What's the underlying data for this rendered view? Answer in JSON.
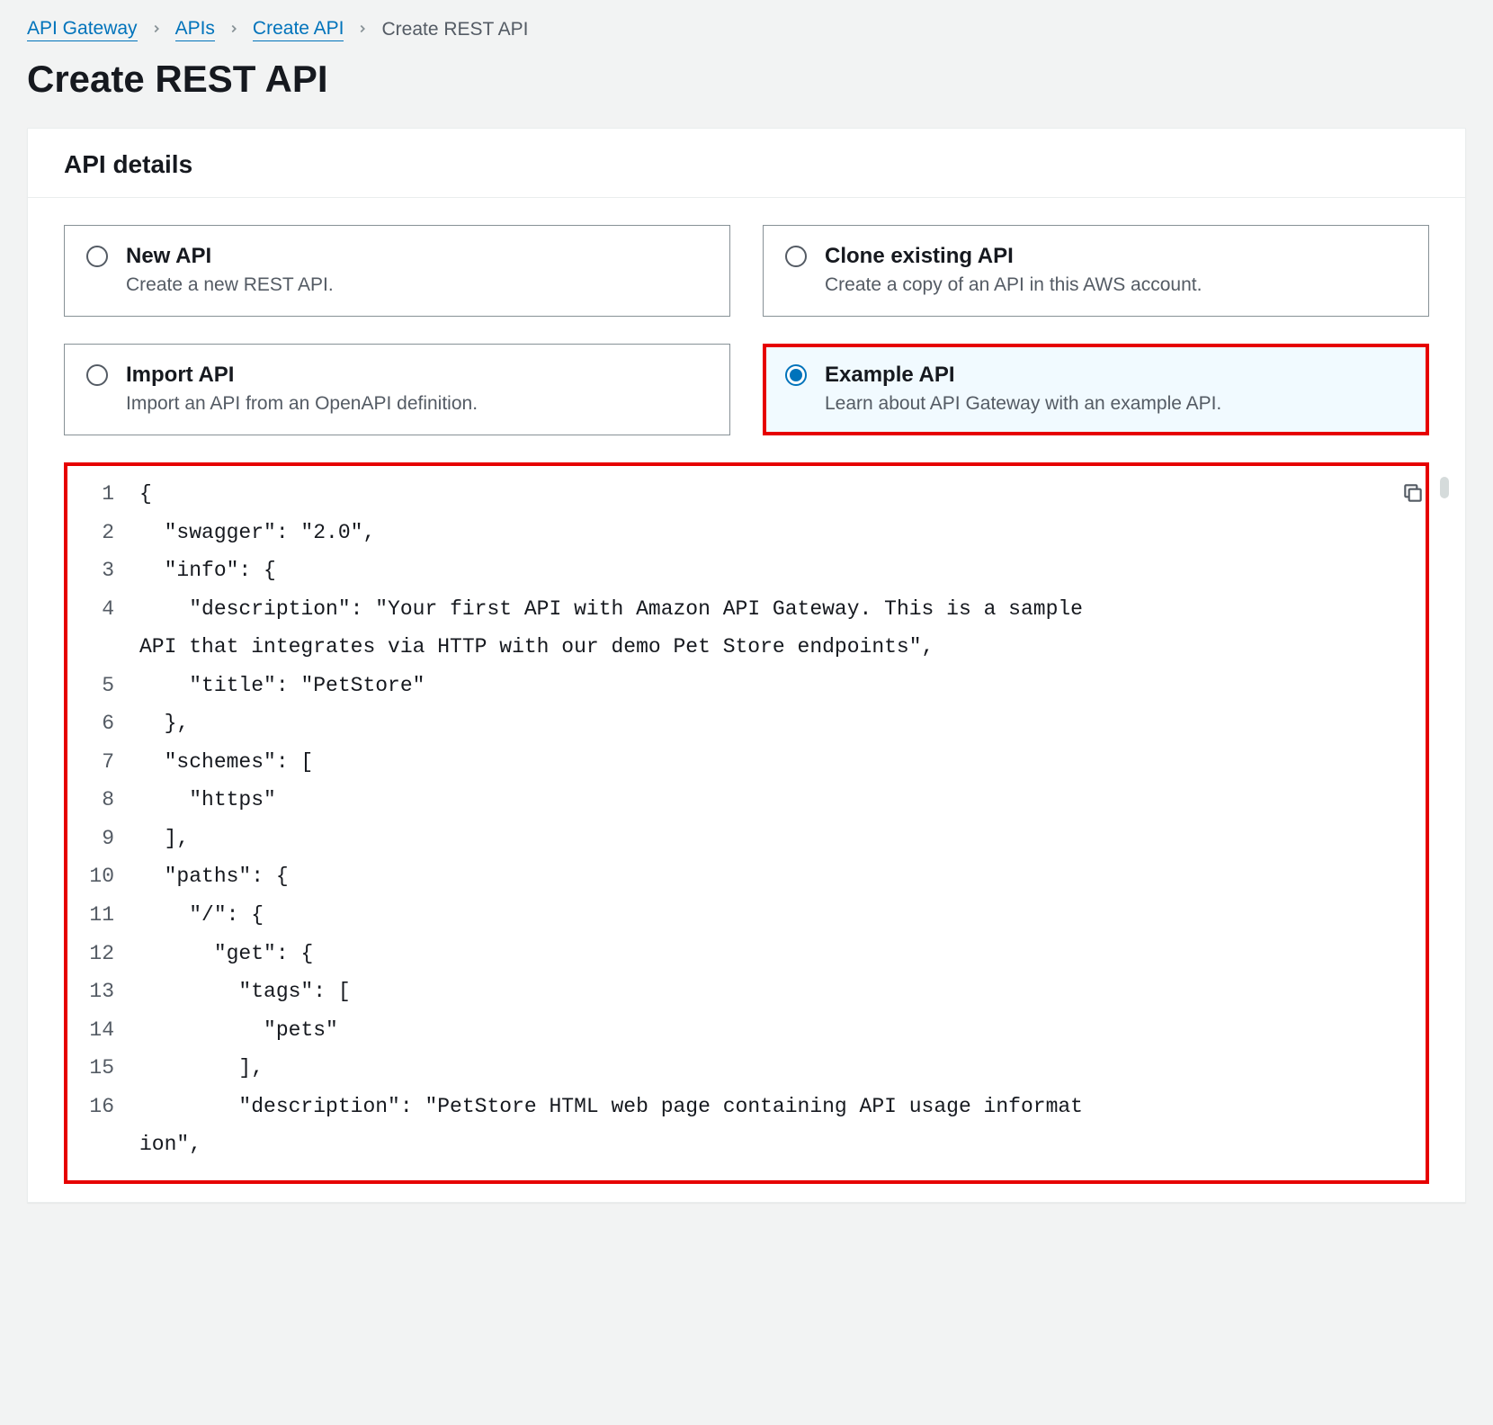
{
  "breadcrumb": {
    "items": [
      {
        "label": "API Gateway",
        "link": true
      },
      {
        "label": "APIs",
        "link": true
      },
      {
        "label": "Create API",
        "link": true
      },
      {
        "label": "Create REST API",
        "link": false
      }
    ]
  },
  "page_title": "Create REST API",
  "panel": {
    "heading": "API details",
    "options": [
      {
        "title": "New API",
        "desc": "Create a new REST API.",
        "selected": false
      },
      {
        "title": "Clone existing API",
        "desc": "Create a copy of an API in this AWS account.",
        "selected": false
      },
      {
        "title": "Import API",
        "desc": "Import an API from an OpenAPI definition.",
        "selected": false
      },
      {
        "title": "Example API",
        "desc": "Learn about API Gateway with an example API.",
        "selected": true
      }
    ]
  },
  "code": {
    "lines": [
      {
        "n": "1",
        "t": "{"
      },
      {
        "n": "2",
        "t": "  \"swagger\": \"2.0\","
      },
      {
        "n": "3",
        "t": "  \"info\": {"
      },
      {
        "n": "4",
        "t": "    \"description\": \"Your first API with Amazon API Gateway. This is a sample "
      },
      {
        "n": "",
        "t": "API that integrates via HTTP with our demo Pet Store endpoints\","
      },
      {
        "n": "5",
        "t": "    \"title\": \"PetStore\""
      },
      {
        "n": "6",
        "t": "  },"
      },
      {
        "n": "7",
        "t": "  \"schemes\": ["
      },
      {
        "n": "8",
        "t": "    \"https\""
      },
      {
        "n": "9",
        "t": "  ],"
      },
      {
        "n": "10",
        "t": "  \"paths\": {"
      },
      {
        "n": "11",
        "t": "    \"/\": {"
      },
      {
        "n": "12",
        "t": "      \"get\": {"
      },
      {
        "n": "13",
        "t": "        \"tags\": ["
      },
      {
        "n": "14",
        "t": "          \"pets\""
      },
      {
        "n": "15",
        "t": "        ],"
      },
      {
        "n": "16",
        "t": "        \"description\": \"PetStore HTML web page containing API usage informat"
      },
      {
        "n": "",
        "t": "ion\","
      }
    ]
  }
}
